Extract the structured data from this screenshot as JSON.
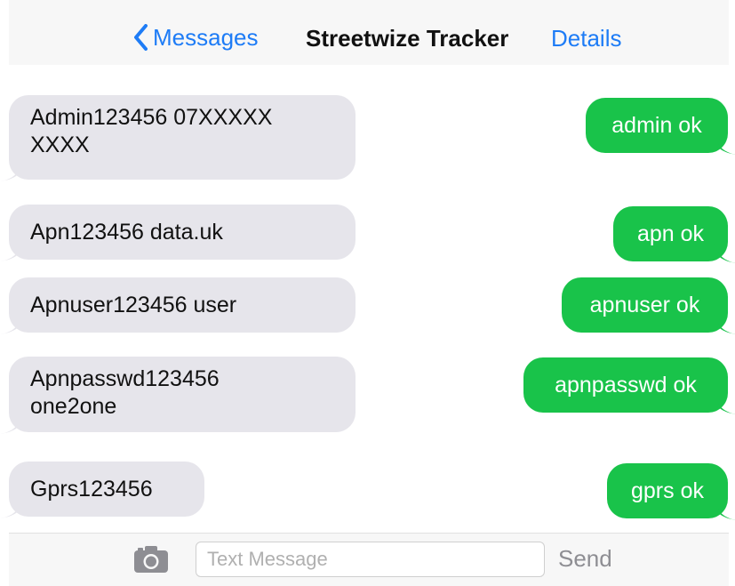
{
  "header": {
    "back_label": "Messages",
    "title": "Streetwize Tracker",
    "details_label": "Details"
  },
  "messages": [
    {
      "direction": "incoming",
      "line1": "Admin123456  07XXXXX",
      "line2": "XXXX"
    },
    {
      "direction": "outgoing",
      "text": "admin ok"
    },
    {
      "direction": "incoming",
      "line1": "Apn123456  data.uk"
    },
    {
      "direction": "outgoing",
      "text": "apn ok"
    },
    {
      "direction": "incoming",
      "line1": "Apnuser123456  user"
    },
    {
      "direction": "outgoing",
      "text": "apnuser ok"
    },
    {
      "direction": "incoming",
      "line1": "Apnpasswd123456",
      "line2": "one2one"
    },
    {
      "direction": "outgoing",
      "text": "apnpasswd ok"
    },
    {
      "direction": "incoming",
      "line1": "Gprs123456"
    },
    {
      "direction": "outgoing",
      "text": "gprs ok"
    }
  ],
  "input_bar": {
    "camera_icon": "camera-icon",
    "placeholder": "Text Message",
    "send_label": "Send"
  },
  "colors": {
    "accent": "#1e7cf6",
    "outgoing_bubble": "#19c34a",
    "incoming_bubble": "#e6e5eb",
    "bar_background": "#f7f7f7"
  }
}
